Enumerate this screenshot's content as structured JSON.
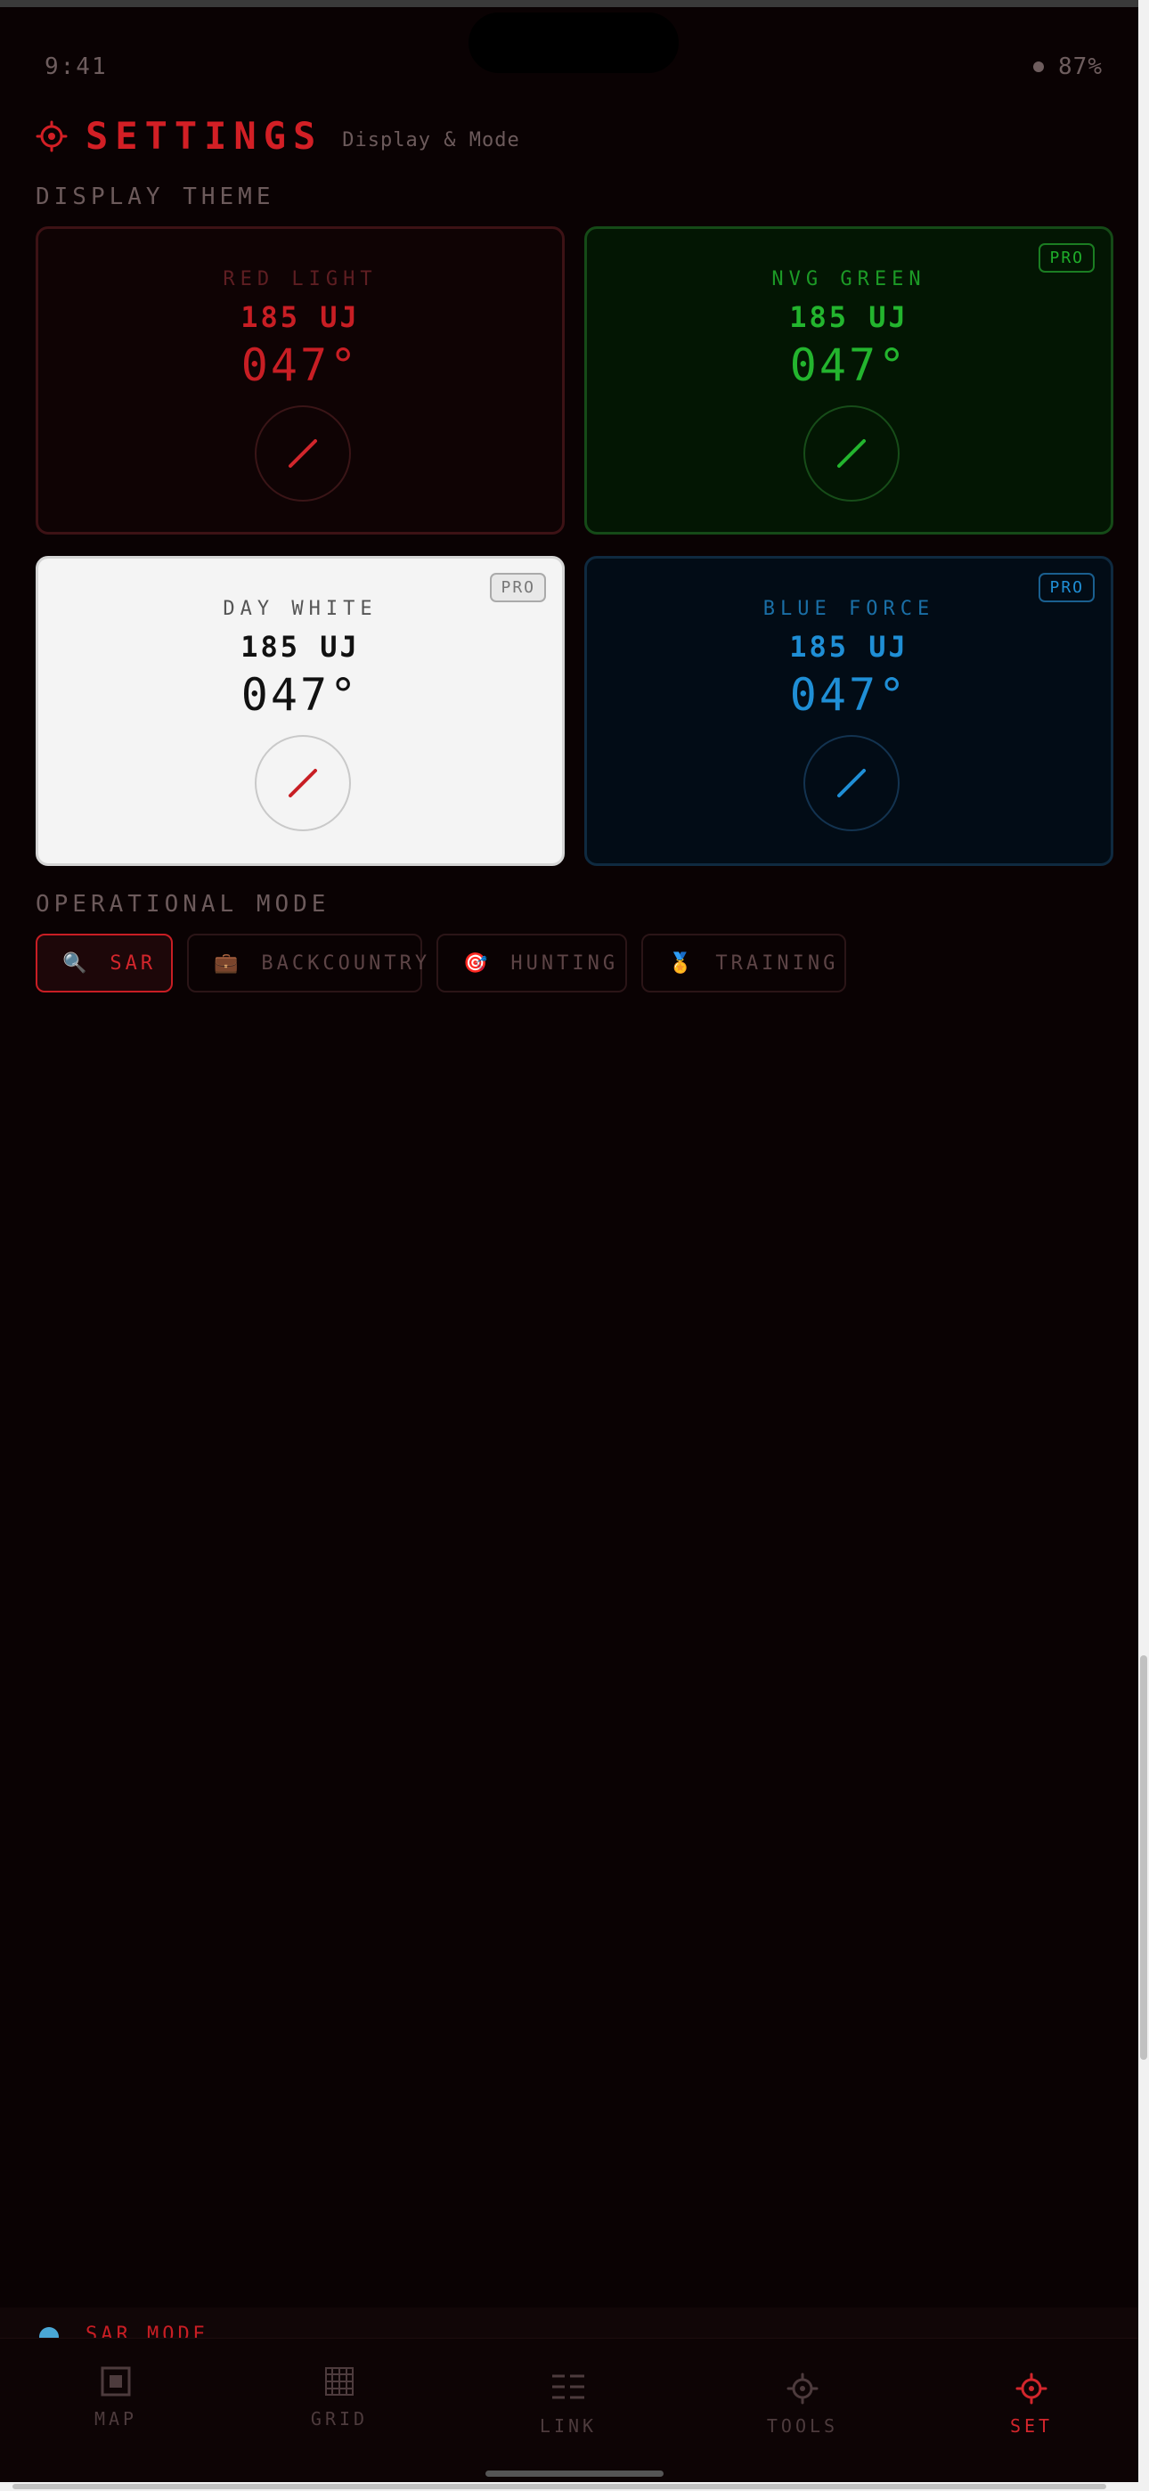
{
  "status_bar": {
    "time": "9:41",
    "battery": "87%"
  },
  "header": {
    "title": "SETTINGS",
    "subtitle": "Display & Mode"
  },
  "display_theme": {
    "label": "DISPLAY THEME",
    "themes": [
      {
        "name": "RED LIGHT",
        "uj": "185 UJ",
        "heading": "047°",
        "pro": ""
      },
      {
        "name": "NVG GREEN",
        "uj": "185 UJ",
        "heading": "047°",
        "pro": "PRO"
      },
      {
        "name": "DAY WHITE",
        "uj": "185 UJ",
        "heading": "047°",
        "pro": "PRO"
      },
      {
        "name": "BLUE FORCE",
        "uj": "185 UJ",
        "heading": "047°",
        "pro": "PRO"
      }
    ]
  },
  "operational_mode": {
    "label": "OPERATIONAL MODE",
    "modes": [
      {
        "icon": "🔍",
        "label": "SAR",
        "active": true
      },
      {
        "icon": "💼",
        "label": "BACKCOUNTRY",
        "active": false
      },
      {
        "icon": "🎯",
        "label": "HUNTING",
        "active": false
      },
      {
        "icon": "🏅",
        "label": "TRAINING",
        "active": false
      }
    ]
  },
  "mode_strip": {
    "text": "SAR MODE"
  },
  "nav": [
    {
      "label": "MAP",
      "icon": "map-icon"
    },
    {
      "label": "GRID",
      "icon": "grid-icon"
    },
    {
      "label": "LINK",
      "icon": "link-icon"
    },
    {
      "label": "TOOLS",
      "icon": "tools-icon"
    },
    {
      "label": "SET",
      "icon": "settings-icon",
      "active": true
    }
  ],
  "colors": {
    "accent": "#c81e24",
    "background": "#0a0203",
    "nvg_green": "#1fae2a",
    "blue_force": "#1f8fd6",
    "day_white_bg": "#f4f4f4"
  }
}
